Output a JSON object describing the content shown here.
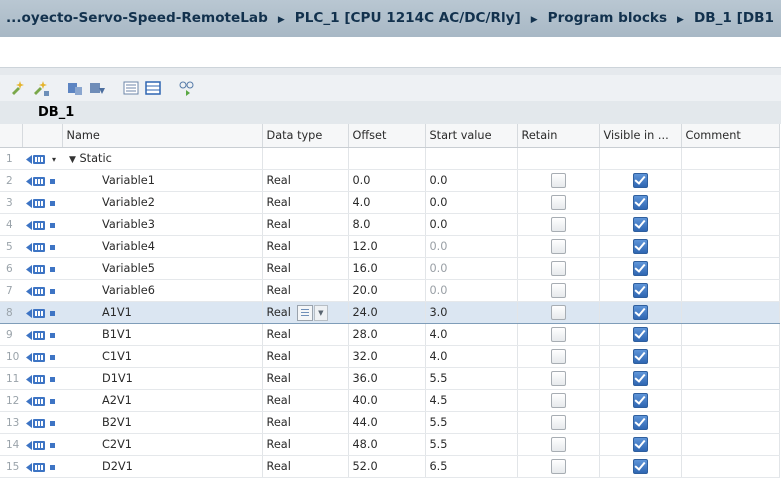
{
  "breadcrumb": [
    "...oyecto-Servo-Speed-RemoteLab",
    "PLC_1 [CPU 1214C AC/DC/Rly]",
    "Program blocks",
    "DB_1 [DB1"
  ],
  "block_title": "DB_1",
  "columns": [
    "",
    "",
    "Name",
    "Data type",
    "Offset",
    "Start value",
    "Retain",
    "Visible in ...",
    "Comment"
  ],
  "rows": [
    {
      "num": "1",
      "name": "Static",
      "type": "",
      "offset": "",
      "start": "",
      "retain": null,
      "visible": null,
      "header": true
    },
    {
      "num": "2",
      "name": "Variable1",
      "type": "Real",
      "offset": "0.0",
      "start": "0.0",
      "retain": false,
      "visible": true
    },
    {
      "num": "3",
      "name": "Variable2",
      "type": "Real",
      "offset": "4.0",
      "start": "0.0",
      "retain": false,
      "visible": true
    },
    {
      "num": "4",
      "name": "Variable3",
      "type": "Real",
      "offset": "8.0",
      "start": "0.0",
      "retain": false,
      "visible": true
    },
    {
      "num": "5",
      "name": "Variable4",
      "type": "Real",
      "offset": "12.0",
      "start": "0.0",
      "retain": false,
      "visible": true,
      "dim": true
    },
    {
      "num": "6",
      "name": "Variable5",
      "type": "Real",
      "offset": "16.0",
      "start": "0.0",
      "retain": false,
      "visible": true,
      "dim": true
    },
    {
      "num": "7",
      "name": "Variable6",
      "type": "Real",
      "offset": "20.0",
      "start": "0.0",
      "retain": false,
      "visible": true,
      "dim": true
    },
    {
      "num": "8",
      "name": "A1V1",
      "type": "Real",
      "offset": "24.0",
      "start": "3.0",
      "retain": false,
      "visible": true,
      "selected": true
    },
    {
      "num": "9",
      "name": "B1V1",
      "type": "Real",
      "offset": "28.0",
      "start": "4.0",
      "retain": false,
      "visible": true
    },
    {
      "num": "10",
      "name": "C1V1",
      "type": "Real",
      "offset": "32.0",
      "start": "4.0",
      "retain": false,
      "visible": true
    },
    {
      "num": "11",
      "name": "D1V1",
      "type": "Real",
      "offset": "36.0",
      "start": "5.5",
      "retain": false,
      "visible": true
    },
    {
      "num": "12",
      "name": "A2V1",
      "type": "Real",
      "offset": "40.0",
      "start": "4.5",
      "retain": false,
      "visible": true
    },
    {
      "num": "13",
      "name": "B2V1",
      "type": "Real",
      "offset": "44.0",
      "start": "5.5",
      "retain": false,
      "visible": true
    },
    {
      "num": "14",
      "name": "C2V1",
      "type": "Real",
      "offset": "48.0",
      "start": "5.5",
      "retain": false,
      "visible": true
    },
    {
      "num": "15",
      "name": "D2V1",
      "type": "Real",
      "offset": "52.0",
      "start": "6.5",
      "retain": false,
      "visible": true
    }
  ],
  "toolbar_icons": [
    "insert-row-icon",
    "add-row-icon",
    "snapshot-icon",
    "copy-snapshot-icon",
    "expanded-view-icon",
    "collapsed-view-icon",
    "monitor-icon"
  ],
  "colors": {
    "title_bg": "#b0bfcb",
    "selected_row": "#dbe6f2",
    "check_blue": "#2f66b2"
  }
}
